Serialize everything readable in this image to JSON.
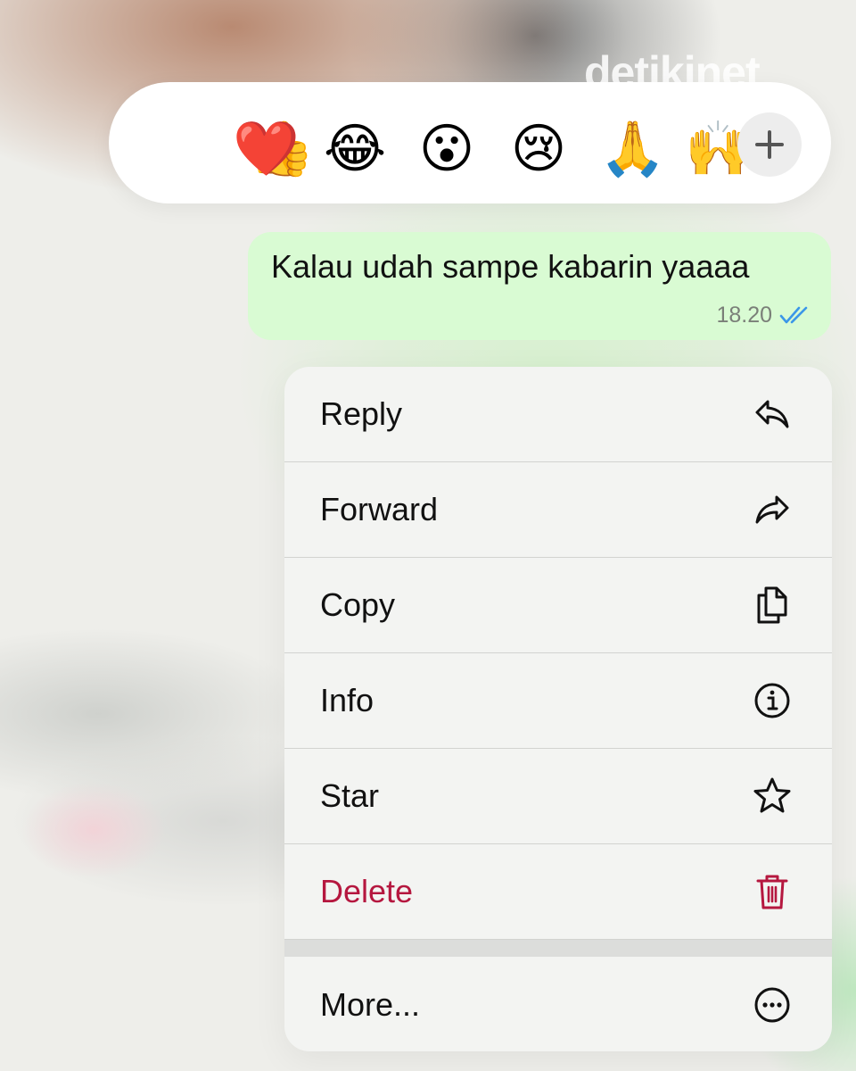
{
  "watermark": "detikinet",
  "reactions": {
    "emojis": [
      {
        "name": "thumbs-up",
        "glyph": "👍"
      },
      {
        "name": "red-heart",
        "glyph": "❤️"
      },
      {
        "name": "tears-of-joy",
        "glyph": "😂"
      },
      {
        "name": "surprised",
        "glyph": "😮"
      },
      {
        "name": "crying",
        "glyph": "😢"
      },
      {
        "name": "folded-hands",
        "glyph": "🙏"
      },
      {
        "name": "raised-hand",
        "glyph": "🙌"
      }
    ],
    "more_icon": "plus-icon"
  },
  "message": {
    "text": "Kalau udah sampe kabarin yaaaa",
    "time": "18.20",
    "status_icon": "double-check-read-icon",
    "bubble_color": "#d9fbd3",
    "check_color": "#3b97e8"
  },
  "menu": {
    "items": [
      {
        "label": "Reply",
        "icon": "reply-icon"
      },
      {
        "label": "Forward",
        "icon": "forward-icon"
      },
      {
        "label": "Copy",
        "icon": "copy-icon"
      },
      {
        "label": "Info",
        "icon": "info-icon"
      },
      {
        "label": "Star",
        "icon": "star-icon"
      },
      {
        "label": "Delete",
        "icon": "trash-icon"
      },
      {
        "label": "More...",
        "icon": "more-icon"
      }
    ],
    "danger_color": "#b5173f"
  }
}
